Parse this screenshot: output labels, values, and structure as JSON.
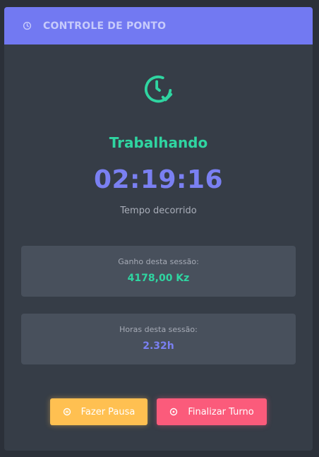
{
  "header": {
    "title": "CONTROLE DE PONTO",
    "icon": "clock-icon"
  },
  "status": {
    "icon": "clock-check-icon",
    "text": "Trabalhando"
  },
  "timer": {
    "value": "02:19:16",
    "label": "Tempo decorrido"
  },
  "stats": {
    "earnings": {
      "label": "Ganho desta sessão:",
      "value": "4178,00 Kz"
    },
    "hours": {
      "label": "Horas desta sessão:",
      "value": "2.32h"
    }
  },
  "actions": {
    "pause": {
      "label": "Fazer Pausa",
      "icon": "pause-circle-icon"
    },
    "end": {
      "label": "Finalizar Turno",
      "icon": "stop-circle-icon"
    }
  },
  "colors": {
    "header_bg": "#7279f2",
    "accent_green": "#2fd5a1",
    "accent_blue": "#7a80f2",
    "pause_button": "#ffc051",
    "end_button": "#fb5b7b"
  }
}
